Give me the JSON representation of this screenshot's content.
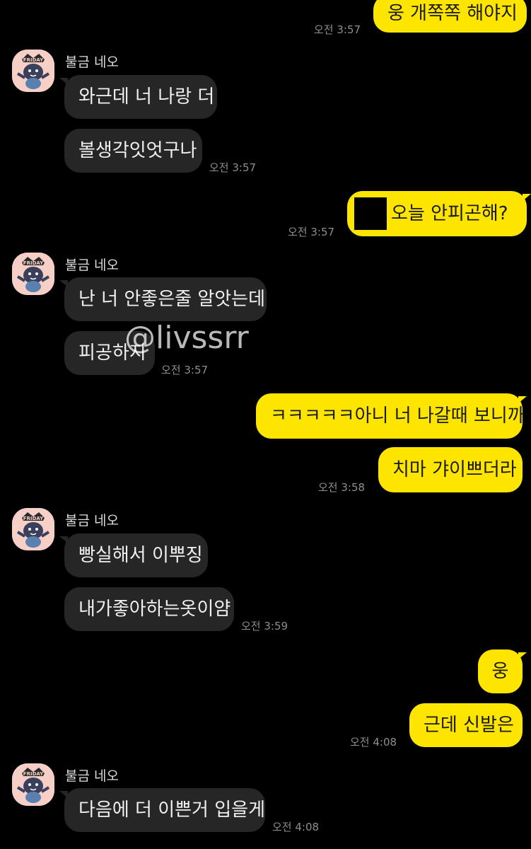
{
  "contact_name": "불금 네오",
  "watermark": "@livssrr",
  "colors": {
    "background": "#000000",
    "incoming_bubble": "#262626",
    "outgoing_bubble": "#FEE500"
  },
  "messages": [
    {
      "text": "웅 개쪽쪽 해야지",
      "time": "오전 3:57",
      "from": "me"
    },
    {
      "text": "와근데 너 나랑 더",
      "from": "them"
    },
    {
      "text": "볼생각잇엇구나",
      "time": "오전 3:57",
      "from": "them"
    },
    {
      "text": "오늘 안피곤해?",
      "time": "오전 3:57",
      "from": "me",
      "has_redaction": true
    },
    {
      "text": "난 너 안좋은줄 알앗는데",
      "from": "them"
    },
    {
      "text": "피공하지",
      "time": "오전 3:57",
      "from": "them"
    },
    {
      "text": "ㅋㅋㅋㅋㅋ아니 너 나갈때 보니까",
      "from": "me"
    },
    {
      "text": "치마 갸이쁘더라",
      "time": "오전 3:58",
      "from": "me"
    },
    {
      "text": "빵실해서 이뿌징",
      "from": "them"
    },
    {
      "text": "내가좋아하는옷이얌",
      "time": "오전 3:59",
      "from": "them"
    },
    {
      "text": "웅",
      "from": "me"
    },
    {
      "text": "근데 신발은",
      "time": "오전 4:08",
      "from": "me"
    },
    {
      "text": "다음에 더 이쁜거 입을게",
      "time": "오전 4:08",
      "from": "them"
    }
  ]
}
